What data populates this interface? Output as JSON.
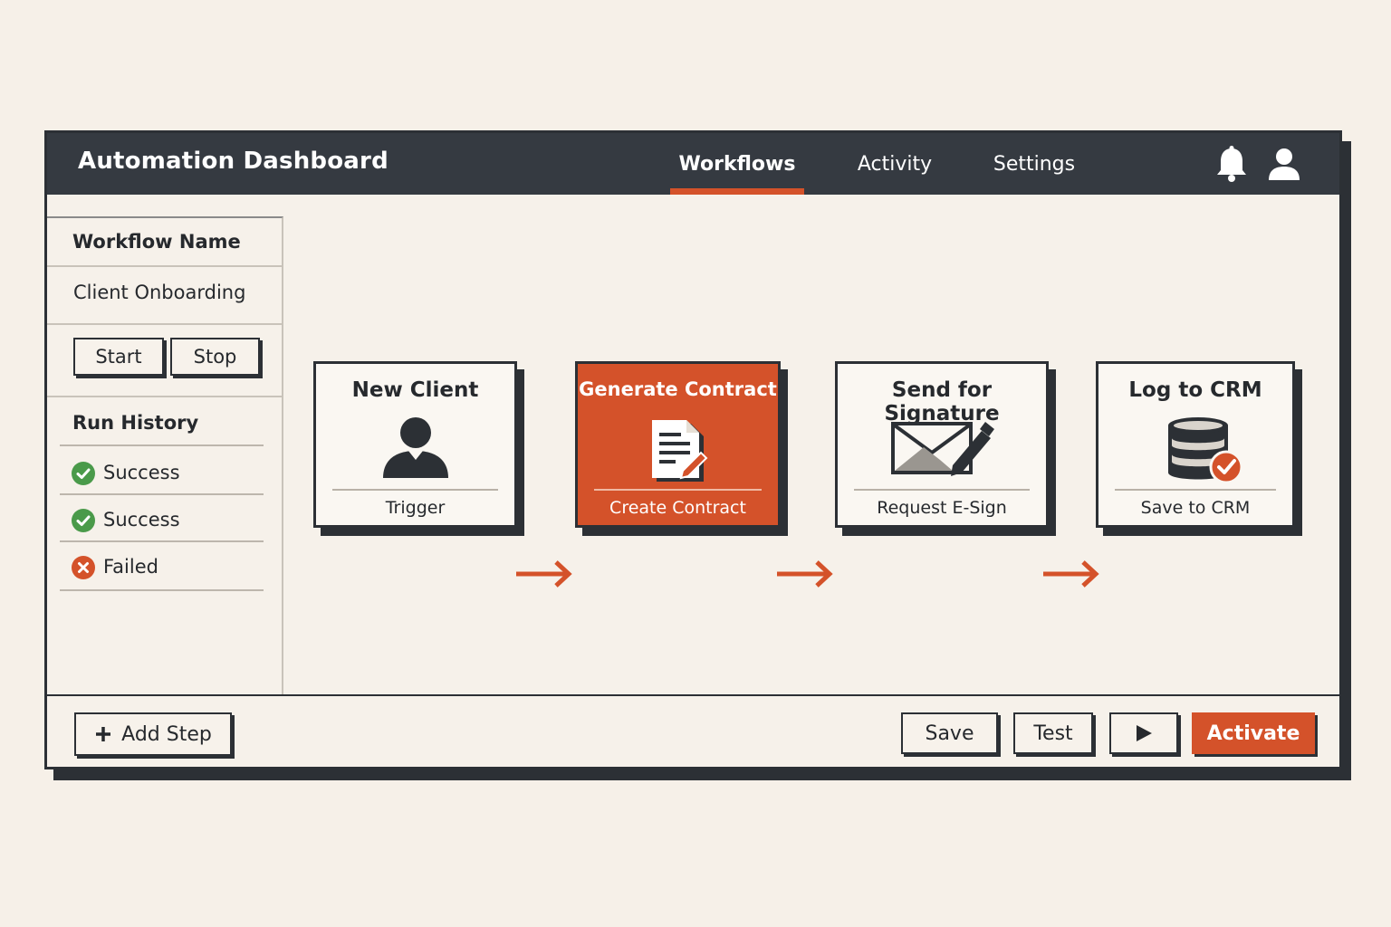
{
  "header": {
    "title": "Automation Dashboard",
    "tabs": [
      {
        "label": "Workflows",
        "active": true
      },
      {
        "label": "Activity",
        "active": false
      },
      {
        "label": "Settings",
        "active": false
      }
    ],
    "icons": [
      "bell-icon",
      "user-icon"
    ]
  },
  "sidebar": {
    "workflow_name_heading": "Workflow Name",
    "workflow_name": "Client Onboarding",
    "start_label": "Start",
    "stop_label": "Stop",
    "run_history_heading": "Run History",
    "runs": [
      {
        "status": "Success",
        "icon": "check-circle-icon",
        "color": "#4a9a4a"
      },
      {
        "status": "Success",
        "icon": "check-circle-icon",
        "color": "#4a9a4a"
      },
      {
        "status": "Failed",
        "icon": "x-circle-icon",
        "color": "#d4522a"
      }
    ]
  },
  "workflow": {
    "steps": [
      {
        "title": "New Client",
        "subtitle": "Trigger",
        "icon": "person-icon",
        "active": false
      },
      {
        "title": "Generate Contract",
        "subtitle": "Create Contract",
        "icon": "document-edit-icon",
        "active": true
      },
      {
        "title": "Send for Signature",
        "subtitle": "Request E-Sign",
        "icon": "envelope-pen-icon",
        "active": false
      },
      {
        "title": "Log to CRM",
        "subtitle": "Save to CRM",
        "icon": "database-check-icon",
        "active": false
      }
    ]
  },
  "footer": {
    "add_step_label": "Add Step",
    "save_label": "Save",
    "test_label": "Test",
    "run_icon": "play-icon",
    "activate_label": "Activate"
  },
  "colors": {
    "accent": "#d4522a",
    "header_bg": "#353a41",
    "background": "#f6f0e8",
    "success": "#4a9a4a"
  }
}
